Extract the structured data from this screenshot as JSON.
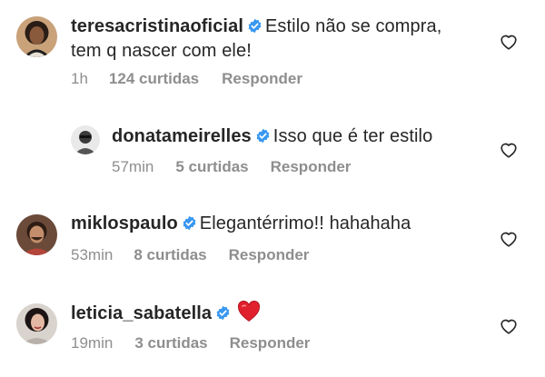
{
  "comments": [
    {
      "username": "teresacristinaoficial",
      "text_line1": "Estilo não se compra,",
      "text_line2": "tem q nascer com ele!",
      "time": "1h",
      "likes": "124 curtidas",
      "reply": "Responder"
    },
    {
      "username": "donatameirelles",
      "text": "Isso que é ter estilo",
      "time": "57min",
      "likes": "5 curtidas",
      "reply": "Responder"
    },
    {
      "username": "miklospaulo",
      "text": "Elegantérrimo!! hahahaha",
      "time": "53min",
      "likes": "8 curtidas",
      "reply": "Responder"
    },
    {
      "username": "leticia_sabatella",
      "emoji": "red-heart-emoji",
      "time": "19min",
      "likes": "3 curtidas",
      "reply": "Responder"
    }
  ],
  "colors": {
    "verified": "#3897f0",
    "heart": "#ed4956",
    "meta": "#8e8e8e",
    "text": "#262626"
  }
}
